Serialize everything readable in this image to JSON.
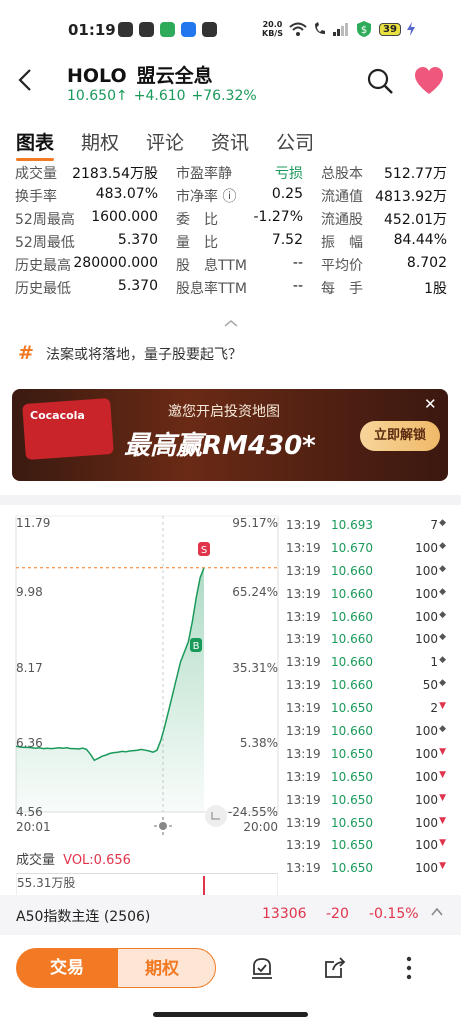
{
  "status": {
    "time": "01:19",
    "speed_top": "20.0",
    "speed_bottom": "KB/S",
    "battery": "39"
  },
  "header": {
    "symbol": "HOLO",
    "name": "盟云全息",
    "price": "10.650",
    "arrow": "↑",
    "change": "+4.610",
    "change_pct": "+76.32%"
  },
  "tabs": [
    "图表",
    "期权",
    "评论",
    "资讯",
    "公司"
  ],
  "stats": [
    [
      [
        "成交量",
        "2183.54万股"
      ],
      [
        "市盈率静",
        "亏损"
      ],
      [
        "总股本",
        "512.77万"
      ]
    ],
    [
      [
        "换手率",
        "483.07%"
      ],
      [
        "市净率 ⓘ",
        "0.25"
      ],
      [
        "流通值",
        "4813.92万"
      ]
    ],
    [
      [
        "52周最高",
        "1600.000"
      ],
      [
        "委　比",
        "-1.27%"
      ],
      [
        "流通股",
        "452.01万"
      ]
    ],
    [
      [
        "52周最低",
        "5.370"
      ],
      [
        "量　比",
        "7.52"
      ],
      [
        "振　幅",
        "84.44%"
      ]
    ],
    [
      [
        "历史最高",
        "280000.000"
      ],
      [
        "股　息TTM",
        "--"
      ],
      [
        "平均价",
        "8.702"
      ]
    ],
    [
      [
        "历史最低",
        "5.370"
      ],
      [
        "股息率TTM",
        "--"
      ],
      [
        "每　手",
        "1股"
      ]
    ]
  ],
  "topic": {
    "text": "法案或将落地，量子股要起飞？"
  },
  "banner": {
    "card_text": "Cocacola",
    "top_text": "邀您开启投资地图",
    "big_text": "最高赢RM430*",
    "button": "立即解锁",
    "close": "✕"
  },
  "chart": {
    "y_left": [
      "11.79",
      "9.98",
      "8.17",
      "6.36",
      "4.56"
    ],
    "y_right": [
      "95.17%",
      "65.24%",
      "35.31%",
      "5.38%",
      "-24.55%"
    ],
    "x_start": "20:01",
    "x_end": "20:00",
    "marker_s": "S",
    "marker_b": "B",
    "vol_label": "成交量",
    "vol_value": "VOL:0.656",
    "vol_max": "55.31万股"
  },
  "chart_data": {
    "type": "line",
    "ylim": [
      4.56,
      11.79
    ],
    "series": [
      {
        "values": [
          6.2,
          6.18,
          6.17,
          6.17,
          6.16,
          6.15,
          6.16,
          6.14,
          6.15,
          6.14,
          6.15,
          6.16,
          6.15,
          6.16,
          6.14,
          6.14,
          6.13,
          6.15,
          6.12,
          6.0,
          5.85,
          5.9,
          5.95,
          5.98,
          6.02,
          6.04,
          6.05,
          6.07,
          6.06,
          6.08,
          6.09,
          6.1,
          6.12,
          6.1,
          6.08,
          6.05,
          6.1,
          6.35,
          6.7,
          7.1,
          7.5,
          7.9,
          8.3,
          8.55,
          8.8,
          9.3,
          9.9,
          10.4,
          10.65
        ]
      }
    ],
    "reference_price": 10.65
  },
  "ticks": [
    {
      "t": "13:19",
      "p": "10.693",
      "v": "7",
      "d": "◆"
    },
    {
      "t": "13:19",
      "p": "10.670",
      "v": "100",
      "d": "◆"
    },
    {
      "t": "13:19",
      "p": "10.660",
      "v": "100",
      "d": "◆"
    },
    {
      "t": "13:19",
      "p": "10.660",
      "v": "100",
      "d": "◆"
    },
    {
      "t": "13:19",
      "p": "10.660",
      "v": "100",
      "d": "◆"
    },
    {
      "t": "13:19",
      "p": "10.660",
      "v": "100",
      "d": "◆"
    },
    {
      "t": "13:19",
      "p": "10.660",
      "v": "1",
      "d": "◆"
    },
    {
      "t": "13:19",
      "p": "10.660",
      "v": "50",
      "d": "◆"
    },
    {
      "t": "13:19",
      "p": "10.650",
      "v": "2",
      "d": "▼"
    },
    {
      "t": "13:19",
      "p": "10.660",
      "v": "100",
      "d": "◆"
    },
    {
      "t": "13:19",
      "p": "10.650",
      "v": "100",
      "d": "▼"
    },
    {
      "t": "13:19",
      "p": "10.650",
      "v": "100",
      "d": "▼"
    },
    {
      "t": "13:19",
      "p": "10.650",
      "v": "100",
      "d": "▼"
    },
    {
      "t": "13:19",
      "p": "10.650",
      "v": "100",
      "d": "▼"
    },
    {
      "t": "13:19",
      "p": "10.650",
      "v": "100",
      "d": "▼"
    },
    {
      "t": "13:19",
      "p": "10.650",
      "v": "100",
      "d": "▼"
    }
  ],
  "index_bar": {
    "name": "A50指数主连 (2506)",
    "price": "13306",
    "change": "-20",
    "pct": "-0.15%"
  },
  "actions": {
    "trade": "交易",
    "options": "期权"
  },
  "colors": {
    "accent": "#f27a24",
    "up": "#1a9a5a",
    "down": "#e0344c"
  }
}
